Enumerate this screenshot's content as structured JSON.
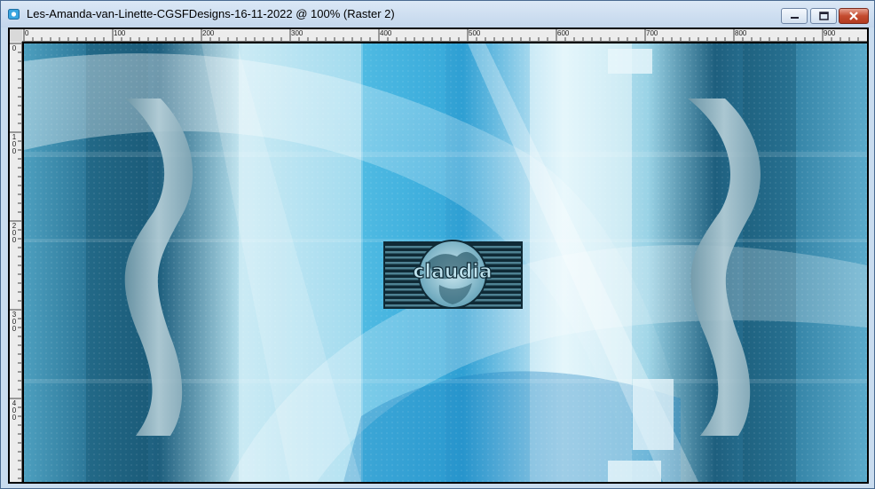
{
  "window": {
    "title": "Les-Amanda-van-Linette-CGSFDesigns-16-11-2022 @ 100% (Raster 2)",
    "controls": [
      "minimize",
      "maximize",
      "close"
    ]
  },
  "ruler": {
    "horizontal": [
      "0",
      "100",
      "200",
      "300",
      "400",
      "500",
      "600",
      "700",
      "800",
      "900"
    ],
    "vertical": [
      "0",
      "100",
      "200",
      "300",
      "400"
    ]
  },
  "canvas": {
    "watermark_text": "claudia",
    "colors": {
      "deep": "#1a5f7d",
      "mid": "#3d9cc4",
      "light": "#cdeef8",
      "accent": "#1e8fd0"
    }
  }
}
